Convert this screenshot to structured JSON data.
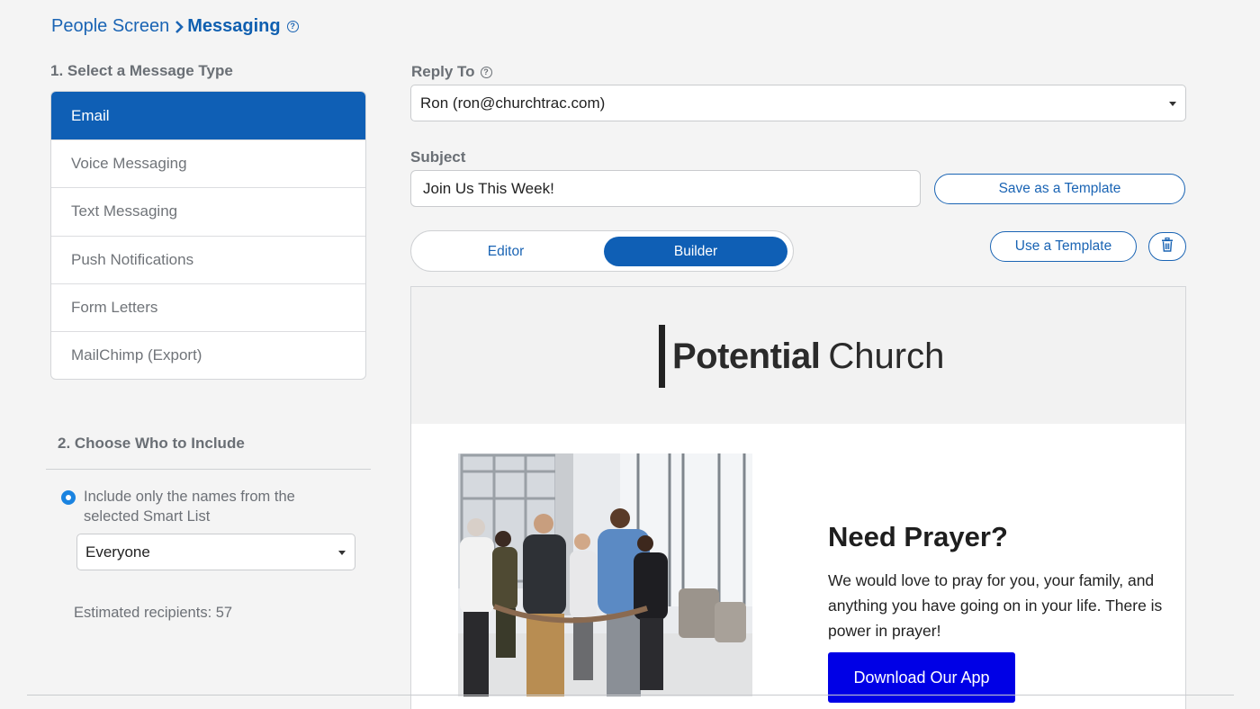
{
  "breadcrumb": {
    "parent": "People Screen",
    "current": "Messaging"
  },
  "message_type": {
    "heading": "1. Select a Message Type",
    "items": [
      {
        "label": "Email",
        "selected": true
      },
      {
        "label": "Voice Messaging"
      },
      {
        "label": "Text Messaging"
      },
      {
        "label": "Push Notifications"
      },
      {
        "label": "Form Letters"
      },
      {
        "label": "MailChimp (Export)"
      }
    ]
  },
  "include": {
    "heading": "2. Choose Who to Include",
    "radio_label": "Include only the names from the selected Smart List",
    "smart_list_value": "Everyone",
    "estimated": "Estimated recipients: 57"
  },
  "reply_to": {
    "label": "Reply To",
    "value": "Ron (ron@churchtrac.com)"
  },
  "subject": {
    "label": "Subject",
    "value": "Join Us This Week!"
  },
  "buttons": {
    "save_template": "Save as a Template",
    "use_template": "Use a Template"
  },
  "mode": {
    "editor": "Editor",
    "builder": "Builder",
    "active": "Builder"
  },
  "preview": {
    "logo_bold": "Potential",
    "logo_light": "Church",
    "title": "Need Prayer?",
    "body": "We would love to pray for you, your family, and anything you have going on in your life. There is power in prayer!",
    "cta": "Download Our App"
  },
  "colors": {
    "accent": "#0f5fb5",
    "cta": "#0000e6",
    "radio": "#1a83e0"
  }
}
